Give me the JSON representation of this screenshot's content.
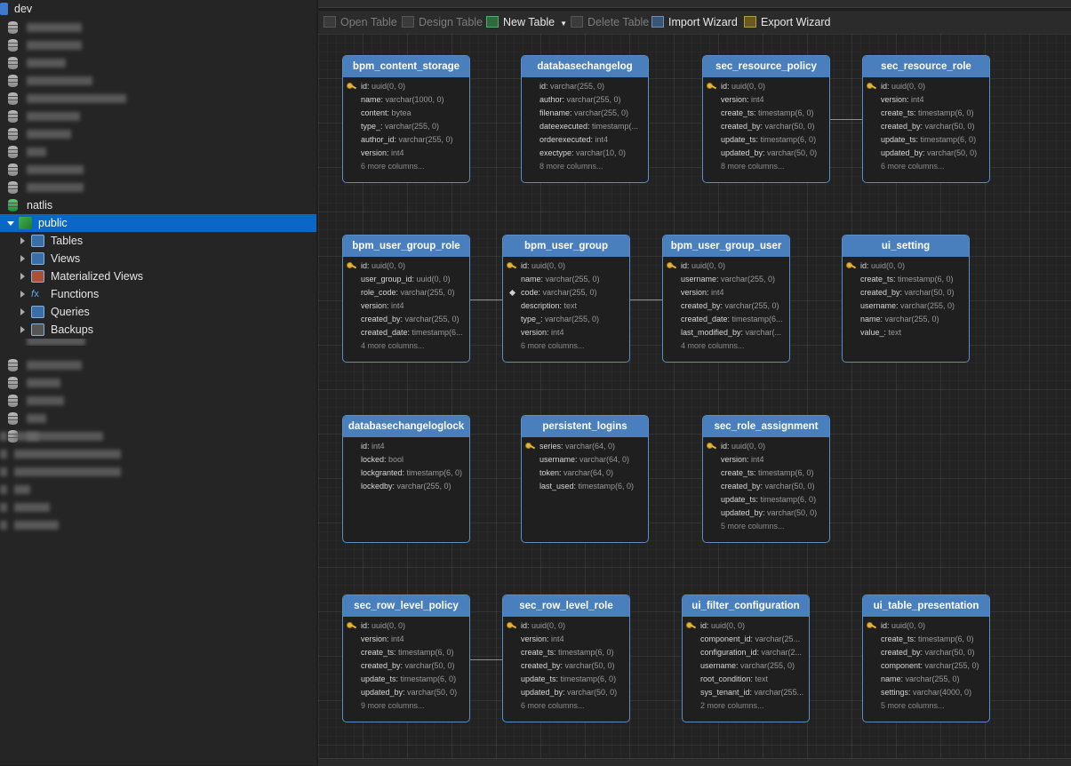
{
  "tree": {
    "dev_label": "dev",
    "natlis_label": "natlis",
    "public_label": "public",
    "children": [
      {
        "label": "Tables",
        "icon": "tables-icon"
      },
      {
        "label": "Views",
        "icon": "views-icon"
      },
      {
        "label": "Materialized Views",
        "icon": "materialized-views-icon"
      },
      {
        "label": "Functions",
        "icon": "functions-icon"
      },
      {
        "label": "Queries",
        "icon": "queries-icon"
      },
      {
        "label": "Backups",
        "icon": "backups-icon"
      }
    ]
  },
  "toolbar": {
    "open_table": "Open Table",
    "design_table": "Design Table",
    "new_table": "New Table",
    "delete_table": "Delete Table",
    "import_wizard": "Import Wizard",
    "export_wizard": "Export Wizard"
  },
  "entities": [
    {
      "name": "bpm_content_storage",
      "columns": [
        {
          "n": "id",
          "t": "uuid(0, 0)",
          "key": true
        },
        {
          "n": "name",
          "t": "varchar(1000, 0)"
        },
        {
          "n": "content",
          "t": "bytea"
        },
        {
          "n": "type_",
          "t": "varchar(255, 0)"
        },
        {
          "n": "author_id",
          "t": "varchar(255, 0)"
        },
        {
          "n": "version",
          "t": "int4"
        }
      ],
      "more": "6 more columns..."
    },
    {
      "name": "databasechangelog",
      "columns": [
        {
          "n": "id",
          "t": "varchar(255, 0)"
        },
        {
          "n": "author",
          "t": "varchar(255, 0)"
        },
        {
          "n": "filename",
          "t": "varchar(255, 0)"
        },
        {
          "n": "dateexecuted",
          "t": "timestamp(..."
        },
        {
          "n": "orderexecuted",
          "t": "int4"
        },
        {
          "n": "exectype",
          "t": "varchar(10, 0)"
        }
      ],
      "more": "8 more columns..."
    },
    {
      "name": "sec_resource_policy",
      "columns": [
        {
          "n": "id",
          "t": "uuid(0, 0)",
          "key": true
        },
        {
          "n": "version",
          "t": "int4"
        },
        {
          "n": "create_ts",
          "t": "timestamp(6, 0)"
        },
        {
          "n": "created_by",
          "t": "varchar(50, 0)"
        },
        {
          "n": "update_ts",
          "t": "timestamp(6, 0)"
        },
        {
          "n": "updated_by",
          "t": "varchar(50, 0)"
        }
      ],
      "more": "8 more columns..."
    },
    {
      "name": "sec_resource_role",
      "columns": [
        {
          "n": "id",
          "t": "uuid(0, 0)",
          "key": true
        },
        {
          "n": "version",
          "t": "int4"
        },
        {
          "n": "create_ts",
          "t": "timestamp(6, 0)"
        },
        {
          "n": "created_by",
          "t": "varchar(50, 0)"
        },
        {
          "n": "update_ts",
          "t": "timestamp(6, 0)"
        },
        {
          "n": "updated_by",
          "t": "varchar(50, 0)"
        }
      ],
      "more": "6 more columns..."
    },
    {
      "name": "bpm_user_group_role",
      "columns": [
        {
          "n": "id",
          "t": "uuid(0, 0)",
          "key": true
        },
        {
          "n": "user_group_id",
          "t": "uuid(0, 0)"
        },
        {
          "n": "role_code",
          "t": "varchar(255, 0)"
        },
        {
          "n": "version",
          "t": "int4"
        },
        {
          "n": "created_by",
          "t": "varchar(255, 0)"
        },
        {
          "n": "created_date",
          "t": "timestamp(6..."
        }
      ],
      "more": "4 more columns..."
    },
    {
      "name": "bpm_user_group",
      "columns": [
        {
          "n": "id",
          "t": "uuid(0, 0)",
          "key": true
        },
        {
          "n": "name",
          "t": "varchar(255, 0)"
        },
        {
          "n": "code",
          "t": "varchar(255, 0)",
          "diamond": true
        },
        {
          "n": "description",
          "t": "text"
        },
        {
          "n": "type_",
          "t": "varchar(255, 0)"
        },
        {
          "n": "version",
          "t": "int4"
        }
      ],
      "more": "6 more columns..."
    },
    {
      "name": "bpm_user_group_user",
      "columns": [
        {
          "n": "id",
          "t": "uuid(0, 0)",
          "key": true
        },
        {
          "n": "username",
          "t": "varchar(255, 0)"
        },
        {
          "n": "version",
          "t": "int4"
        },
        {
          "n": "created_by",
          "t": "varchar(255, 0)"
        },
        {
          "n": "created_date",
          "t": "timestamp(6..."
        },
        {
          "n": "last_modified_by",
          "t": "varchar(..."
        }
      ],
      "more": "4 more columns..."
    },
    {
      "name": "ui_setting",
      "columns": [
        {
          "n": "id",
          "t": "uuid(0, 0)",
          "key": true
        },
        {
          "n": "create_ts",
          "t": "timestamp(6, 0)"
        },
        {
          "n": "created_by",
          "t": "varchar(50, 0)"
        },
        {
          "n": "username",
          "t": "varchar(255, 0)"
        },
        {
          "n": "name",
          "t": "varchar(255, 0)"
        },
        {
          "n": "value_",
          "t": "text"
        }
      ],
      "more": ""
    },
    {
      "name": "databasechangeloglock",
      "columns": [
        {
          "n": "id",
          "t": "int4"
        },
        {
          "n": "locked",
          "t": "bool"
        },
        {
          "n": "lockgranted",
          "t": "timestamp(6, 0)"
        },
        {
          "n": "lockedby",
          "t": "varchar(255, 0)"
        }
      ],
      "more": ""
    },
    {
      "name": "persistent_logins",
      "columns": [
        {
          "n": "series",
          "t": "varchar(64, 0)",
          "key": true
        },
        {
          "n": "username",
          "t": "varchar(64, 0)"
        },
        {
          "n": "token",
          "t": "varchar(64, 0)"
        },
        {
          "n": "last_used",
          "t": "timestamp(6, 0)"
        }
      ],
      "more": ""
    },
    {
      "name": "sec_role_assignment",
      "columns": [
        {
          "n": "id",
          "t": "uuid(0, 0)",
          "key": true
        },
        {
          "n": "version",
          "t": "int4"
        },
        {
          "n": "create_ts",
          "t": "timestamp(6, 0)"
        },
        {
          "n": "created_by",
          "t": "varchar(50, 0)"
        },
        {
          "n": "update_ts",
          "t": "timestamp(6, 0)"
        },
        {
          "n": "updated_by",
          "t": "varchar(50, 0)"
        }
      ],
      "more": "5 more columns..."
    },
    {
      "name": "sec_row_level_policy",
      "columns": [
        {
          "n": "id",
          "t": "uuid(0, 0)",
          "key": true
        },
        {
          "n": "version",
          "t": "int4"
        },
        {
          "n": "create_ts",
          "t": "timestamp(6, 0)"
        },
        {
          "n": "created_by",
          "t": "varchar(50, 0)"
        },
        {
          "n": "update_ts",
          "t": "timestamp(6, 0)"
        },
        {
          "n": "updated_by",
          "t": "varchar(50, 0)"
        }
      ],
      "more": "9 more columns..."
    },
    {
      "name": "sec_row_level_role",
      "columns": [
        {
          "n": "id",
          "t": "uuid(0, 0)",
          "key": true
        },
        {
          "n": "version",
          "t": "int4"
        },
        {
          "n": "create_ts",
          "t": "timestamp(6, 0)"
        },
        {
          "n": "created_by",
          "t": "varchar(50, 0)"
        },
        {
          "n": "update_ts",
          "t": "timestamp(6, 0)"
        },
        {
          "n": "updated_by",
          "t": "varchar(50, 0)"
        }
      ],
      "more": "6 more columns..."
    },
    {
      "name": "ui_filter_configuration",
      "columns": [
        {
          "n": "id",
          "t": "uuid(0, 0)",
          "key": true
        },
        {
          "n": "component_id",
          "t": "varchar(25..."
        },
        {
          "n": "configuration_id",
          "t": "varchar(2..."
        },
        {
          "n": "username",
          "t": "varchar(255, 0)"
        },
        {
          "n": "root_condition",
          "t": "text"
        },
        {
          "n": "sys_tenant_id",
          "t": "varchar(255..."
        }
      ],
      "more": "2 more columns..."
    },
    {
      "name": "ui_table_presentation",
      "columns": [
        {
          "n": "id",
          "t": "uuid(0, 0)",
          "key": true
        },
        {
          "n": "create_ts",
          "t": "timestamp(6, 0)"
        },
        {
          "n": "created_by",
          "t": "varchar(50, 0)"
        },
        {
          "n": "component",
          "t": "varchar(255, 0)"
        },
        {
          "n": "name",
          "t": "varchar(255, 0)"
        },
        {
          "n": "settings",
          "t": "varchar(4000, 0)"
        }
      ],
      "more": "5 more columns..."
    }
  ]
}
